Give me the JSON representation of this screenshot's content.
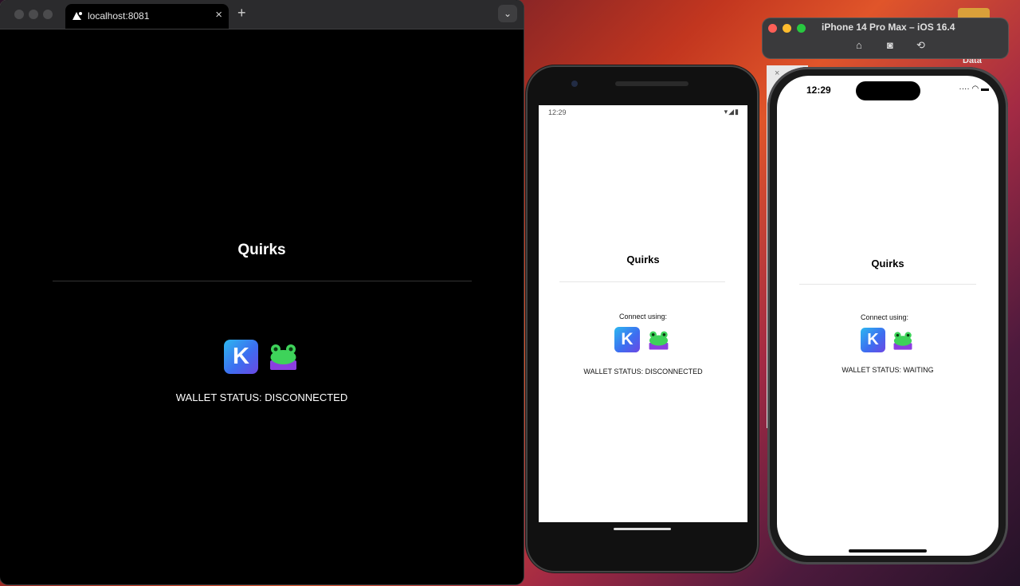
{
  "browser": {
    "tab_title": "localhost:8081",
    "close_glyph": "×",
    "new_tab_glyph": "+",
    "tab_menu_glyph": "⌄"
  },
  "web_app": {
    "title": "Quirks",
    "wallet_status": "WALLET STATUS: DISCONNECTED",
    "wallet_icons": [
      "K",
      "frog"
    ]
  },
  "android_app": {
    "clock": "12:29",
    "status_icons": "▾◢▮",
    "title": "Quirks",
    "connect_label": "Connect using:",
    "wallet_icons": [
      "K",
      "frog"
    ],
    "wallet_status": "WALLET STATUS: DISCONNECTED"
  },
  "ios_app": {
    "clock": "12:29",
    "status_icons": "···· ◠ ▬",
    "title": "Quirks",
    "connect_label": "Connect using:",
    "wallet_icons": [
      "K",
      "frog"
    ],
    "wallet_status": "WALLET STATUS: WAITING"
  },
  "simulator": {
    "title": "iPhone 14 Pro Max – iOS 16.4",
    "buttons": [
      "home-icon",
      "screenshot-icon",
      "rotate-icon"
    ]
  },
  "desktop": {
    "folder_label": "Data",
    "close_glyph": "×"
  },
  "colors": {
    "k_gradient_start": "#2db8f0",
    "k_gradient_end": "#6c47e4",
    "frog_green": "#3ed35a",
    "frog_base": "#8b3fe0"
  }
}
